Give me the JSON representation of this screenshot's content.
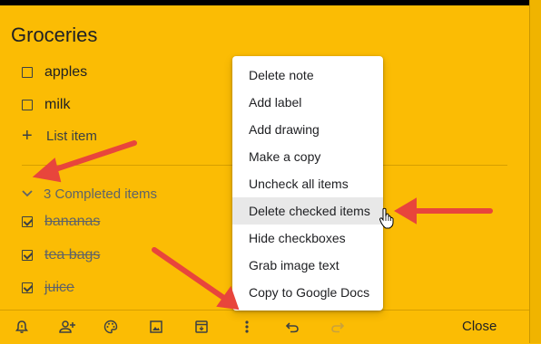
{
  "note": {
    "title": "Groceries",
    "items": [
      {
        "text": "apples",
        "checked": false
      },
      {
        "text": "milk",
        "checked": false
      }
    ],
    "list_item_placeholder": "List item",
    "completed_label": "3 Completed items",
    "completed": [
      {
        "text": "bananas",
        "checked": true
      },
      {
        "text": "tea bags",
        "checked": true
      },
      {
        "text": "juice",
        "checked": true
      }
    ]
  },
  "menu": {
    "items": [
      "Delete note",
      "Add label",
      "Add drawing",
      "Make a copy",
      "Uncheck all items",
      "Delete checked items",
      "Hide checkboxes",
      "Grab image text",
      "Copy to Google Docs"
    ],
    "hovered_index": 5
  },
  "toolbar": {
    "icons": [
      "remind-me-icon",
      "collaborator-icon",
      "palette-icon",
      "image-icon",
      "archive-icon",
      "more-icon",
      "undo-icon",
      "redo-icon"
    ],
    "close_label": "Close"
  },
  "colors": {
    "note_bg": "#fbbc04",
    "arrow": "#e8453c"
  }
}
